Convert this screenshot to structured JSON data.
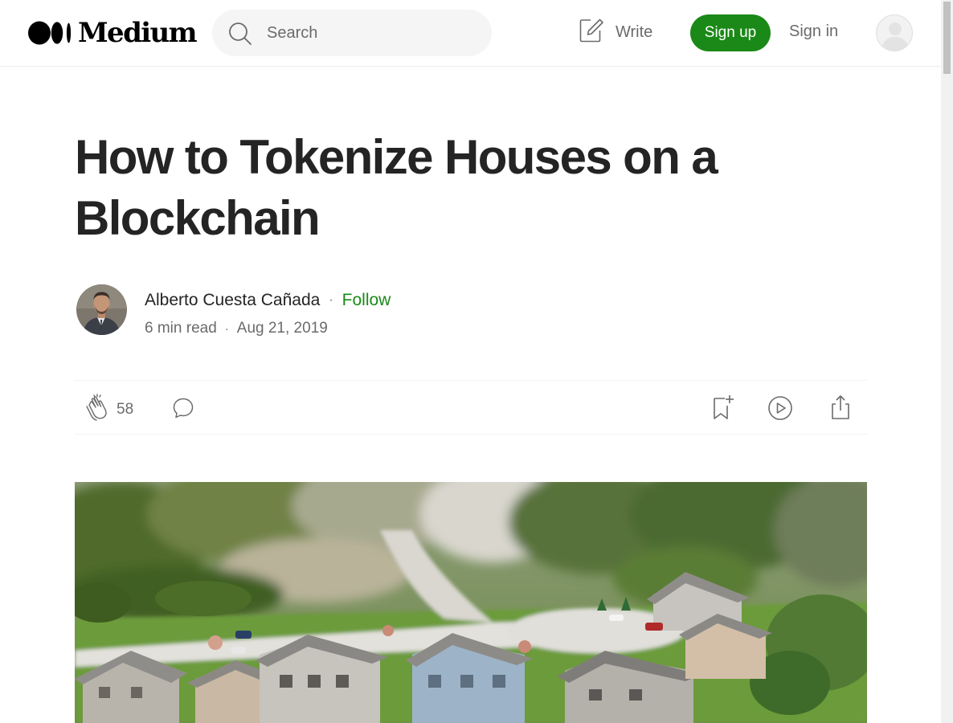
{
  "header": {
    "logo_text": "Medium",
    "search": {
      "placeholder": "Search",
      "icon": "search-icon"
    },
    "write_label": "Write",
    "signup_label": "Sign up",
    "signin_label": "Sign in",
    "brand_color": "#1a8917"
  },
  "article": {
    "title": "How to Tokenize Houses on a Blockchain",
    "author": {
      "name": "Alberto Cuesta Cañada",
      "follow_label": "Follow",
      "separator": "·"
    },
    "read_time": "6 min read",
    "date": "Aug 21, 2019",
    "claps": "58",
    "actions": [
      "clap-icon",
      "comment-icon",
      "bookmark-icon",
      "play-icon",
      "share-icon"
    ]
  }
}
